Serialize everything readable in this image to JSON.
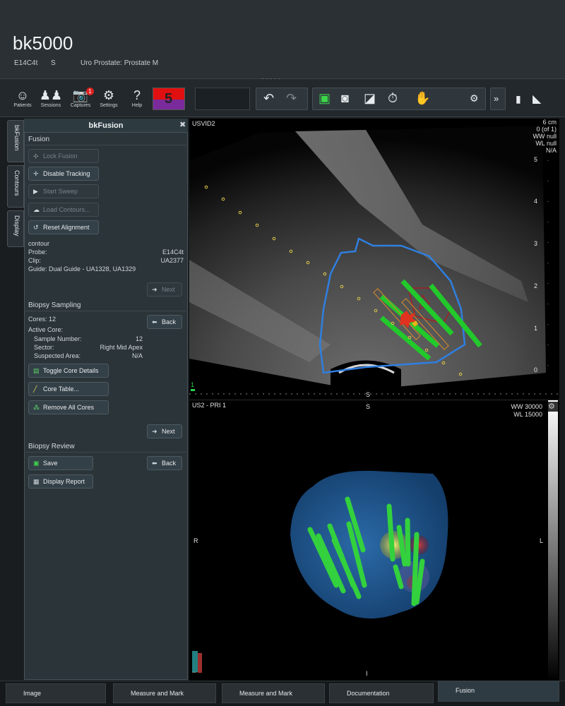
{
  "header": {
    "title": "bk5000",
    "probe": "E14C4t",
    "preset_code": "S",
    "study": "Uro Prostate: Prostate M"
  },
  "toolbar": {
    "patients": "Patients",
    "sessions": "Sessions",
    "captures": "Captures",
    "captures_badge": "1",
    "settings": "Settings",
    "help": "Help",
    "preset_number": "5"
  },
  "side_tabs": [
    "bkFusion",
    "Contours",
    "Display"
  ],
  "panel": {
    "title": "bkFusion",
    "fusion_header": "Fusion",
    "lock_fusion": "Lock Fusion",
    "disable_tracking": "Disable Tracking",
    "start_sweep": "Start Sweep",
    "load_contours": "Load Contours...",
    "reset_alignment": "Reset Alignment",
    "info_title": "contour",
    "probe_label": "Probe:",
    "probe_value": "E14C4t",
    "clip_label": "Clip:",
    "clip_value": "UA2377",
    "guide_label": "Guide: Dual Guide - UA1328, UA1329",
    "next1": "Next",
    "biopsy_sampling_header": "Biopsy Sampling",
    "cores": "Cores: 12",
    "back1": "Back",
    "active_core": "Active Core:",
    "sample_number_label": "Sample Number:",
    "sample_number_value": "12",
    "sector_label": "Sector:",
    "sector_value": "Right Mid Apex",
    "suspected_label": "Suspected Area:",
    "suspected_value": "N/A",
    "toggle_core_details": "Toggle Core Details",
    "core_table": "Core Table...",
    "remove_all_cores": "Remove All Cores",
    "next2": "Next",
    "biopsy_review_header": "Biopsy Review",
    "save": "Save",
    "back2": "Back",
    "display_report": "Display Report"
  },
  "view_top": {
    "label": "USVID2",
    "depth": "6 cm",
    "frame": "0 (of 1)",
    "ww": "WW null",
    "wl": "WL null",
    "na": "N/A",
    "scale": [
      "5",
      "4",
      "3",
      "2",
      "1",
      "0"
    ],
    "bottom_marker": "S",
    "left_marker": "1"
  },
  "view_bottom": {
    "label": "US2 - PRI 1",
    "orientation_top": "S",
    "ww": "WW 30000",
    "wl": "WL 15000",
    "left": "R",
    "right": "L",
    "bottom": "I"
  },
  "bottom_tabs": [
    "Image",
    "Measure and Mark",
    "Measure and Mark",
    "Documentation",
    "Fusion"
  ]
}
